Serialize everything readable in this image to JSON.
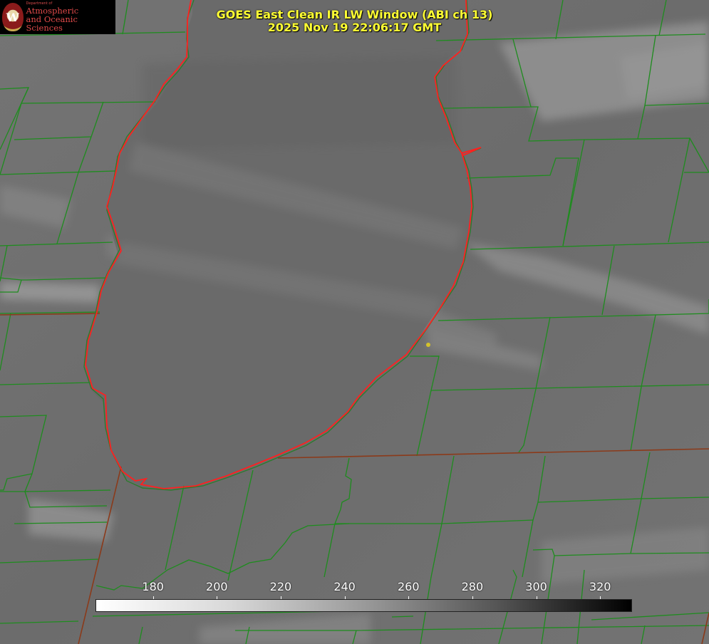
{
  "title": {
    "line1": "GOES East Clean IR LW Window (ABI ch 13)",
    "line2": "2025 Nov 19 22:06:17 GMT"
  },
  "logo": {
    "dept": "Department of",
    "line1": "Atmospheric",
    "line2": "and Oceanic Sciences",
    "seal_letter": "W"
  },
  "colorbar": {
    "min": 162,
    "max": 330,
    "ticks": [
      "180",
      "200",
      "220",
      "240",
      "260",
      "280",
      "300",
      "320"
    ],
    "tick_values": [
      180,
      200,
      220,
      240,
      260,
      280,
      300,
      320
    ]
  },
  "colors": {
    "title": "#ffff33",
    "county_lines": "#1e8c1e",
    "state_lines": "#8b4513",
    "coastline": "#ff2020",
    "marker": "#d4c22a"
  }
}
